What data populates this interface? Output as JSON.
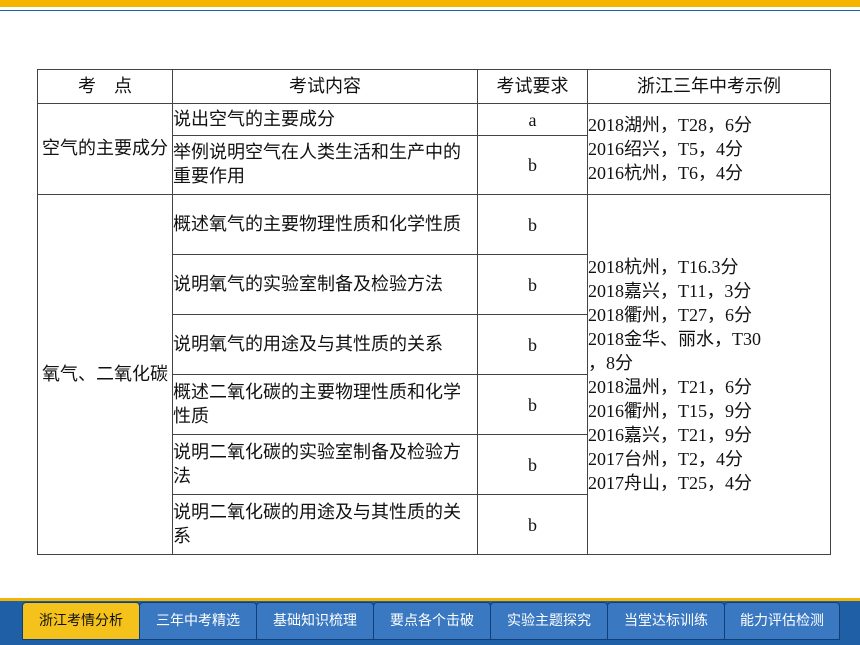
{
  "table": {
    "headers": [
      "考　点",
      "考试内容",
      "考试要求",
      "浙江三年中考示例"
    ],
    "groups": [
      {
        "topic": "空气的主要成分",
        "rows": [
          {
            "content": "说出空气的主要成分",
            "req": "a"
          },
          {
            "content": "举例说明空气在人类生活和生产中的重要作用",
            "req": "b"
          }
        ],
        "examples": [
          "2018湖州，T28，6分",
          "2016绍兴，T5，4分",
          "2016杭州，T6，4分"
        ]
      },
      {
        "topic": "氧气、二氧化碳",
        "rows": [
          {
            "content": "概述氧气的主要物理性质和化学性质",
            "req": "b"
          },
          {
            "content": "说明氧气的实验室制备及检验方法",
            "req": "b"
          },
          {
            "content": "说明氧气的用途及与其性质的关系",
            "req": "b"
          },
          {
            "content": "概述二氧化碳的主要物理性质和化学性质",
            "req": "b"
          },
          {
            "content": "说明二氧化碳的实验室制备及检验方法",
            "req": "b"
          },
          {
            "content": "说明二氧化碳的用途及与其性质的关系",
            "req": "b"
          }
        ],
        "examples": [
          "2018杭州，T16.3分",
          "2018嘉兴，T11，3分",
          "2018衢州，T27，6分",
          "2018金华、丽水，T30",
          "，8分",
          "2018温州，T21，6分",
          "2016衢州，T15，9分",
          "2016嘉兴，T21，9分",
          "2017台州，T2，4分",
          "2017舟山，T25，4分"
        ]
      }
    ]
  },
  "nav": {
    "tabs": [
      "浙江考情分析",
      "三年中考精选",
      "基础知识梳理",
      "要点各个击破",
      "实验主题探究",
      "当堂达标训练",
      "能力评估检测"
    ],
    "active_index": 0
  },
  "colors": {
    "accent": "#f4b400",
    "nav_bg": "#1f5fa6",
    "tab_bg": "#3a78c2",
    "active_tab": "#f4c21a"
  }
}
